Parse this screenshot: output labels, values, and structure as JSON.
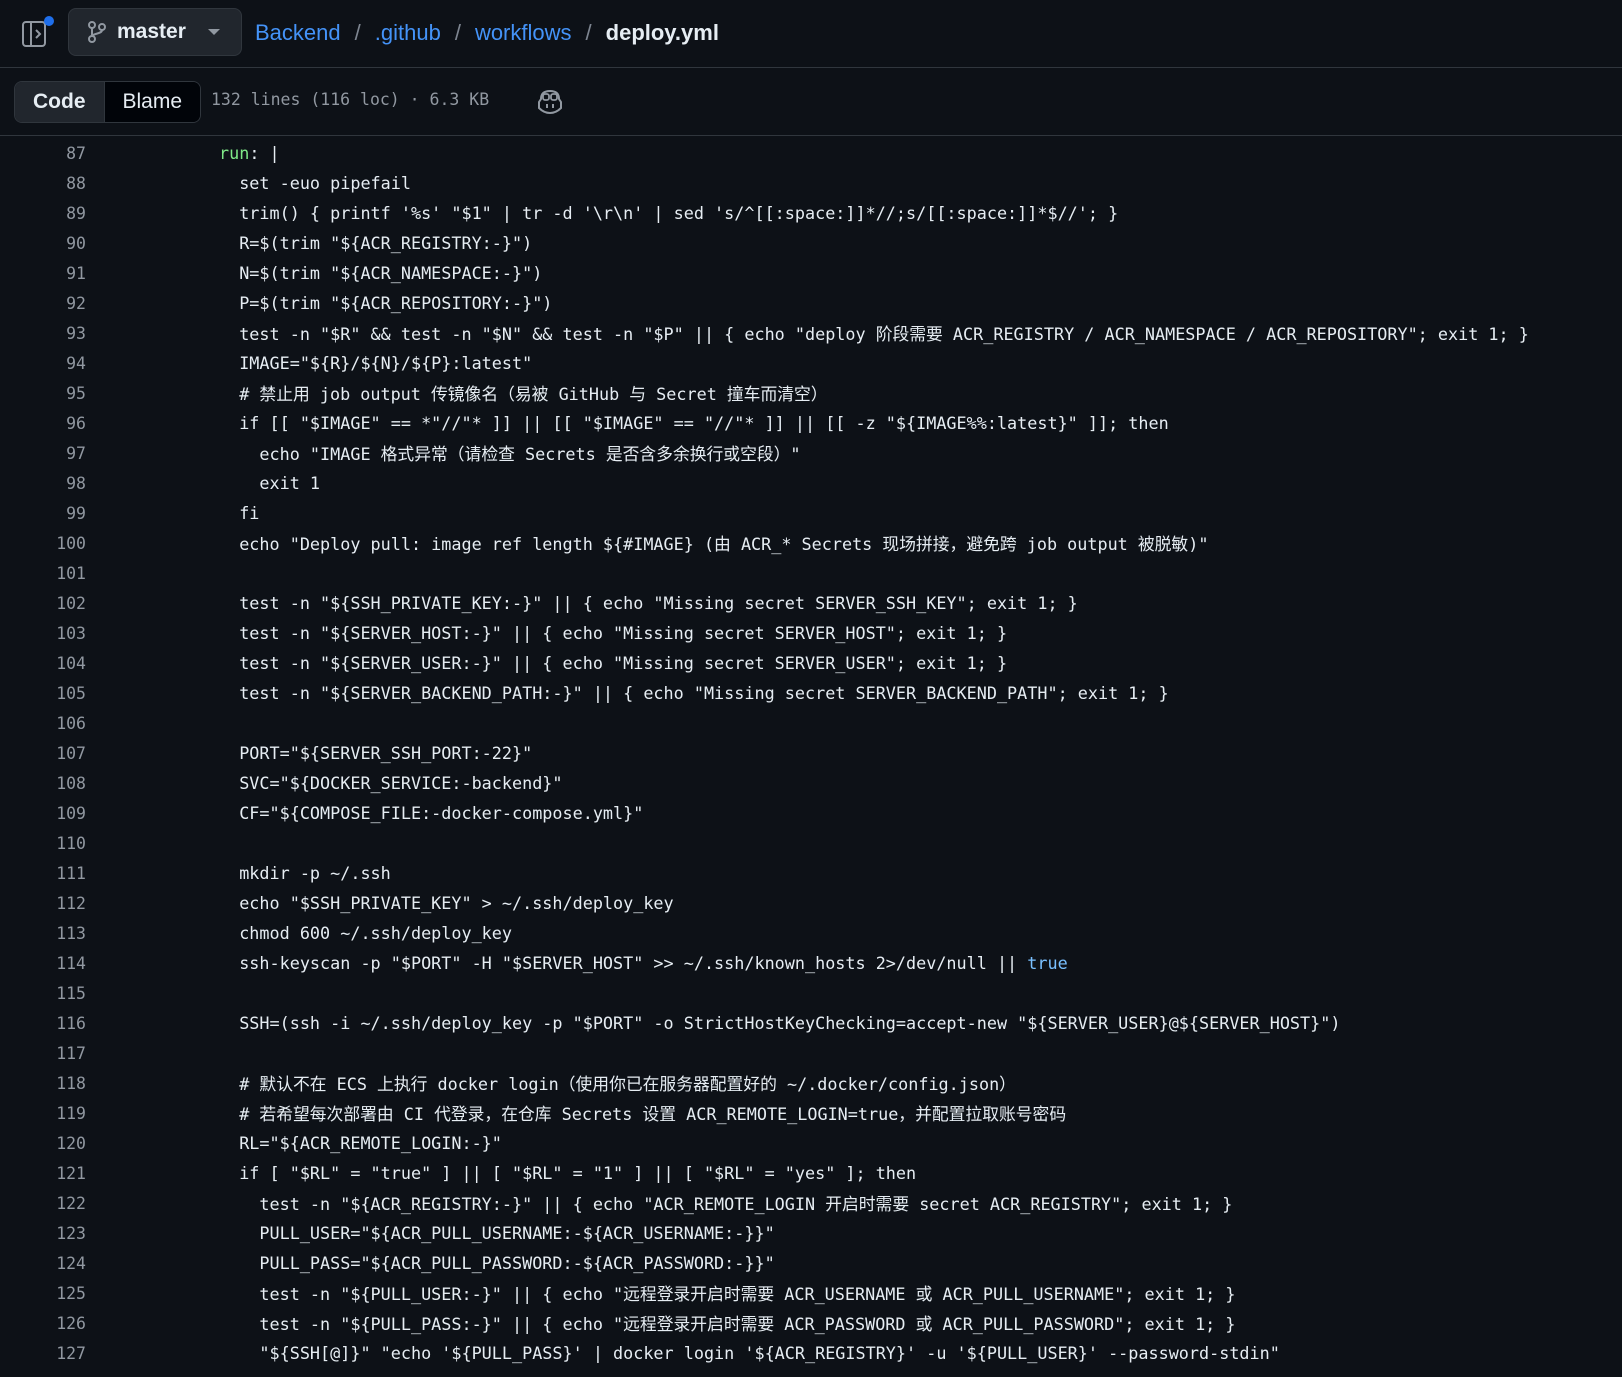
{
  "header": {
    "branch": "master",
    "breadcrumb": {
      "repo": "Backend",
      "dir1": ".github",
      "dir2": "workflows",
      "separator": "/",
      "file": "deploy.yml"
    }
  },
  "toolbar": {
    "code_label": "Code",
    "blame_label": "Blame",
    "file_meta": "132 lines (116 loc) · 6.3 KB"
  },
  "icons": {
    "panel_toggle": "sidebar-expand-icon",
    "branch": "git-branch-icon",
    "caret": "triangle-down-icon",
    "copilot": "copilot-icon"
  },
  "colors": {
    "background": "#0d1117",
    "link": "#4493f8",
    "text": "#e6edf3",
    "muted": "#9198a1",
    "yaml_key": "#7ee787",
    "literal": "#79c0ff"
  },
  "code": {
    "lines": [
      {
        "n": "87",
        "text": "run: |"
      },
      {
        "n": "88",
        "text": "  set -euo pipefail"
      },
      {
        "n": "89",
        "text": "  trim() { printf '%s' \"$1\" | tr -d '\\r\\n' | sed 's/^[[:space:]]*//;s/[[:space:]]*$//'; }"
      },
      {
        "n": "90",
        "text": "  R=$(trim \"${ACR_REGISTRY:-}\")"
      },
      {
        "n": "91",
        "text": "  N=$(trim \"${ACR_NAMESPACE:-}\")"
      },
      {
        "n": "92",
        "text": "  P=$(trim \"${ACR_REPOSITORY:-}\")"
      },
      {
        "n": "93",
        "text": "  test -n \"$R\" && test -n \"$N\" && test -n \"$P\" || { echo \"deploy 阶段需要 ACR_REGISTRY / ACR_NAMESPACE / ACR_REPOSITORY\"; exit 1; }"
      },
      {
        "n": "94",
        "text": "  IMAGE=\"${R}/${N}/${P}:latest\""
      },
      {
        "n": "95",
        "text": "  # 禁止用 job output 传镜像名（易被 GitHub 与 Secret 撞车而清空）"
      },
      {
        "n": "96",
        "text": "  if [[ \"$IMAGE\" == *\"//\"* ]] || [[ \"$IMAGE\" == \"//\"* ]] || [[ -z \"${IMAGE%%:latest}\" ]]; then"
      },
      {
        "n": "97",
        "text": "    echo \"IMAGE 格式异常（请检查 Secrets 是否含多余换行或空段）\""
      },
      {
        "n": "98",
        "text": "    exit 1"
      },
      {
        "n": "99",
        "text": "  fi"
      },
      {
        "n": "100",
        "text": "  echo \"Deploy pull: image ref length ${#IMAGE} (由 ACR_* Secrets 现场拼接，避免跨 job output 被脱敏)\""
      },
      {
        "n": "101",
        "text": ""
      },
      {
        "n": "102",
        "text": "  test -n \"${SSH_PRIVATE_KEY:-}\" || { echo \"Missing secret SERVER_SSH_KEY\"; exit 1; }"
      },
      {
        "n": "103",
        "text": "  test -n \"${SERVER_HOST:-}\" || { echo \"Missing secret SERVER_HOST\"; exit 1; }"
      },
      {
        "n": "104",
        "text": "  test -n \"${SERVER_USER:-}\" || { echo \"Missing secret SERVER_USER\"; exit 1; }"
      },
      {
        "n": "105",
        "text": "  test -n \"${SERVER_BACKEND_PATH:-}\" || { echo \"Missing secret SERVER_BACKEND_PATH\"; exit 1; }"
      },
      {
        "n": "106",
        "text": ""
      },
      {
        "n": "107",
        "text": "  PORT=\"${SERVER_SSH_PORT:-22}\""
      },
      {
        "n": "108",
        "text": "  SVC=\"${DOCKER_SERVICE:-backend}\""
      },
      {
        "n": "109",
        "text": "  CF=\"${COMPOSE_FILE:-docker-compose.yml}\""
      },
      {
        "n": "110",
        "text": ""
      },
      {
        "n": "111",
        "text": "  mkdir -p ~/.ssh"
      },
      {
        "n": "112",
        "text": "  echo \"$SSH_PRIVATE_KEY\" > ~/.ssh/deploy_key"
      },
      {
        "n": "113",
        "text": "  chmod 600 ~/.ssh/deploy_key"
      },
      {
        "n": "114",
        "text": "  ssh-keyscan -p \"$PORT\" -H \"$SERVER_HOST\" >> ~/.ssh/known_hosts 2>/dev/null || ",
        "tail": "true"
      },
      {
        "n": "115",
        "text": ""
      },
      {
        "n": "116",
        "text": "  SSH=(ssh -i ~/.ssh/deploy_key -p \"$PORT\" -o StrictHostKeyChecking=accept-new \"${SERVER_USER}@${SERVER_HOST}\")"
      },
      {
        "n": "117",
        "text": ""
      },
      {
        "n": "118",
        "text": "  # 默认不在 ECS 上执行 docker login（使用你已在服务器配置好的 ~/.docker/config.json）"
      },
      {
        "n": "119",
        "text": "  # 若希望每次部署由 CI 代登录，在仓库 Secrets 设置 ACR_REMOTE_LOGIN=true，并配置拉取账号密码"
      },
      {
        "n": "120",
        "text": "  RL=\"${ACR_REMOTE_LOGIN:-}\""
      },
      {
        "n": "121",
        "text": "  if [ \"$RL\" = \"true\" ] || [ \"$RL\" = \"1\" ] || [ \"$RL\" = \"yes\" ]; then"
      },
      {
        "n": "122",
        "text": "    test -n \"${ACR_REGISTRY:-}\" || { echo \"ACR_REMOTE_LOGIN 开启时需要 secret ACR_REGISTRY\"; exit 1; }"
      },
      {
        "n": "123",
        "text": "    PULL_USER=\"${ACR_PULL_USERNAME:-${ACR_USERNAME:-}}\""
      },
      {
        "n": "124",
        "text": "    PULL_PASS=\"${ACR_PULL_PASSWORD:-${ACR_PASSWORD:-}}\""
      },
      {
        "n": "125",
        "text": "    test -n \"${PULL_USER:-}\" || { echo \"远程登录开启时需要 ACR_USERNAME 或 ACR_PULL_USERNAME\"; exit 1; }"
      },
      {
        "n": "126",
        "text": "    test -n \"${PULL_PASS:-}\" || { echo \"远程登录开启时需要 ACR_PASSWORD 或 ACR_PULL_PASSWORD\"; exit 1; }"
      },
      {
        "n": "127",
        "text": "    \"${SSH[@]}\" \"echo '${PULL_PASS}' | docker login '${ACR_REGISTRY}' -u '${PULL_USER}' --password-stdin\""
      }
    ]
  }
}
